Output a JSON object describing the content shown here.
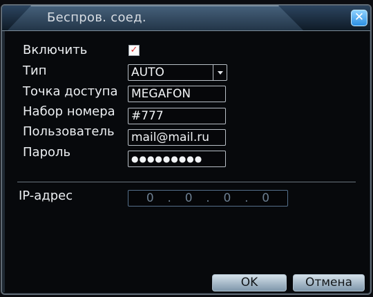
{
  "window": {
    "title": "Беспров. соед."
  },
  "form": {
    "enable_label": "Включить",
    "enable_checked": true,
    "type_label": "Тип",
    "type_value": "AUTO",
    "apn_label": "Точка доступа",
    "apn_value": "MEGAFON",
    "dial_label": "Набор номера",
    "dial_value": "#777",
    "user_label": "Пользователь",
    "user_value": "mail@mail.ru",
    "password_label": "Пароль",
    "password_value": "●●●●●●●●●"
  },
  "network": {
    "ip_label": "IP-адрес",
    "ip_octets": [
      "0",
      "0",
      "0",
      "0"
    ],
    "ip_separator": "."
  },
  "buttons": {
    "ok_label": "OK",
    "cancel_label": "Отмена"
  },
  "icons": {
    "close": "close-icon",
    "checkbox": "check-icon",
    "dropdown": "chevron-down-icon"
  },
  "colors": {
    "checkmark": "#d63434",
    "close_button": "#2c8fe3"
  }
}
